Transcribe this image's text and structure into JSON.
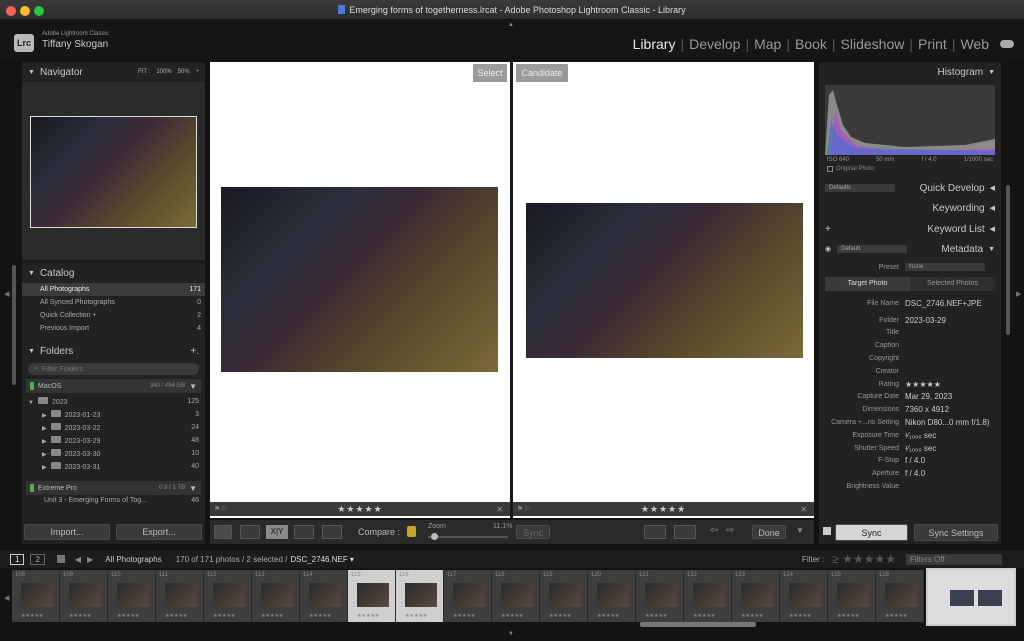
{
  "window": {
    "title": "Emerging forms of togetherness.lrcat - Adobe Photoshop Lightroom Classic - Library"
  },
  "identity": {
    "logo": "Lrc",
    "app": "Adobe Lightroom Classic",
    "user": "Tiffany Skogan"
  },
  "modules": [
    "Library",
    "Develop",
    "Map",
    "Book",
    "Slideshow",
    "Print",
    "Web"
  ],
  "navigator": {
    "title": "Navigator",
    "fit": "FIT :",
    "z1": "100%",
    "z2": "50%",
    "z3": "÷"
  },
  "catalog": {
    "title": "Catalog",
    "items": [
      {
        "label": "All Photographs",
        "count": "171"
      },
      {
        "label": "All Synced Photographs",
        "count": "0"
      },
      {
        "label": "Quick Collection +",
        "count": "2"
      },
      {
        "label": "Previous Import",
        "count": "4"
      }
    ]
  },
  "folders": {
    "title": "Folders",
    "add": "+.",
    "filter_placeholder": "Filter Folders",
    "vol1": {
      "name": "MacOS",
      "size": "340 / 494 GB"
    },
    "year": {
      "name": "2023",
      "count": "125"
    },
    "items": [
      {
        "name": "2023-01-23",
        "count": "3"
      },
      {
        "name": "2023-03-22",
        "count": "24"
      },
      {
        "name": "2023-03-29",
        "count": "48"
      },
      {
        "name": "2023-03-30",
        "count": "10"
      },
      {
        "name": "2023-03-31",
        "count": "40"
      }
    ],
    "vol2": {
      "name": "Extreme Pro",
      "size": "0.9 / 1 TB"
    },
    "sub": {
      "name": "Unit 3 - Emerging Forms of Tog...",
      "count": "46"
    }
  },
  "left_buttons": {
    "import": "Import...",
    "export": "Export..."
  },
  "compare": {
    "select_label": "Select",
    "candidate_label": "Candidate",
    "stars": "★★★★★"
  },
  "toolbar": {
    "compare_label": "Compare :",
    "zoom_label": "Zoom",
    "zoom_value": "11.1%",
    "sync": "Sync",
    "done": "Done",
    "xy": "X|Y"
  },
  "histogram": {
    "title": "Histogram",
    "iso": "ISO 640",
    "focal": "50 mm",
    "fstop": "f / 4.0",
    "shutter": "1/1000 sec",
    "original": "Original Photo"
  },
  "right_panels": {
    "quick_develop": "Quick Develop",
    "defaults": "Defaults",
    "keywording": "Keywording",
    "keyword_list": "Keyword List",
    "metadata": "Metadata",
    "default": "Default",
    "preset_label": "Preset",
    "preset_value": "None",
    "tab_target": "Target Photo",
    "tab_selected": "Selected Photos"
  },
  "metadata": [
    {
      "label": "File Name",
      "value": "DSC_2746.NEF+JPE"
    },
    {
      "label": "Folder",
      "value": "2023-03-29"
    },
    {
      "label": "Title",
      "value": ""
    },
    {
      "label": "Caption",
      "value": ""
    },
    {
      "label": "Copyright",
      "value": ""
    },
    {
      "label": "Creator",
      "value": ""
    },
    {
      "label": "Rating",
      "value": "★★★★★"
    },
    {
      "label": "Capture Date",
      "value": "Mar 29, 2023"
    },
    {
      "label": "Dimensions",
      "value": "7360 x 4912"
    },
    {
      "label": "Camera +...ns Setting",
      "value": "Nikon D80...0 mm f/1.8)"
    },
    {
      "label": "Exposure Time",
      "value": "¹⁄₁₀₀₀ sec"
    },
    {
      "label": "Shutter Speed",
      "value": "¹⁄₁₀₀₀ sec"
    },
    {
      "label": "F-Stop",
      "value": "f / 4.0"
    },
    {
      "label": "Aperture",
      "value": "f / 4.0"
    },
    {
      "label": "Brightness Value",
      "value": ""
    }
  ],
  "right_buttons": {
    "sync": "Sync",
    "sync_settings": "Sync Settings"
  },
  "filmstrip": {
    "page1": "1",
    "page2": "2",
    "source": "All Photographs",
    "count": "170 of 171 photos / 2 selected /",
    "file": "DSC_2746.NEF ▾",
    "filter_label": "Filter :",
    "filter_value": "Filters Off",
    "cells": [
      {
        "n": "108"
      },
      {
        "n": "109"
      },
      {
        "n": "110"
      },
      {
        "n": "111"
      },
      {
        "n": "112"
      },
      {
        "n": "113"
      },
      {
        "n": "114"
      },
      {
        "n": "115"
      },
      {
        "n": "116"
      },
      {
        "n": "117"
      },
      {
        "n": "118"
      },
      {
        "n": "119"
      },
      {
        "n": "120"
      },
      {
        "n": "121"
      },
      {
        "n": "122"
      },
      {
        "n": "123"
      },
      {
        "n": "124"
      },
      {
        "n": "125"
      },
      {
        "n": "126"
      }
    ]
  }
}
